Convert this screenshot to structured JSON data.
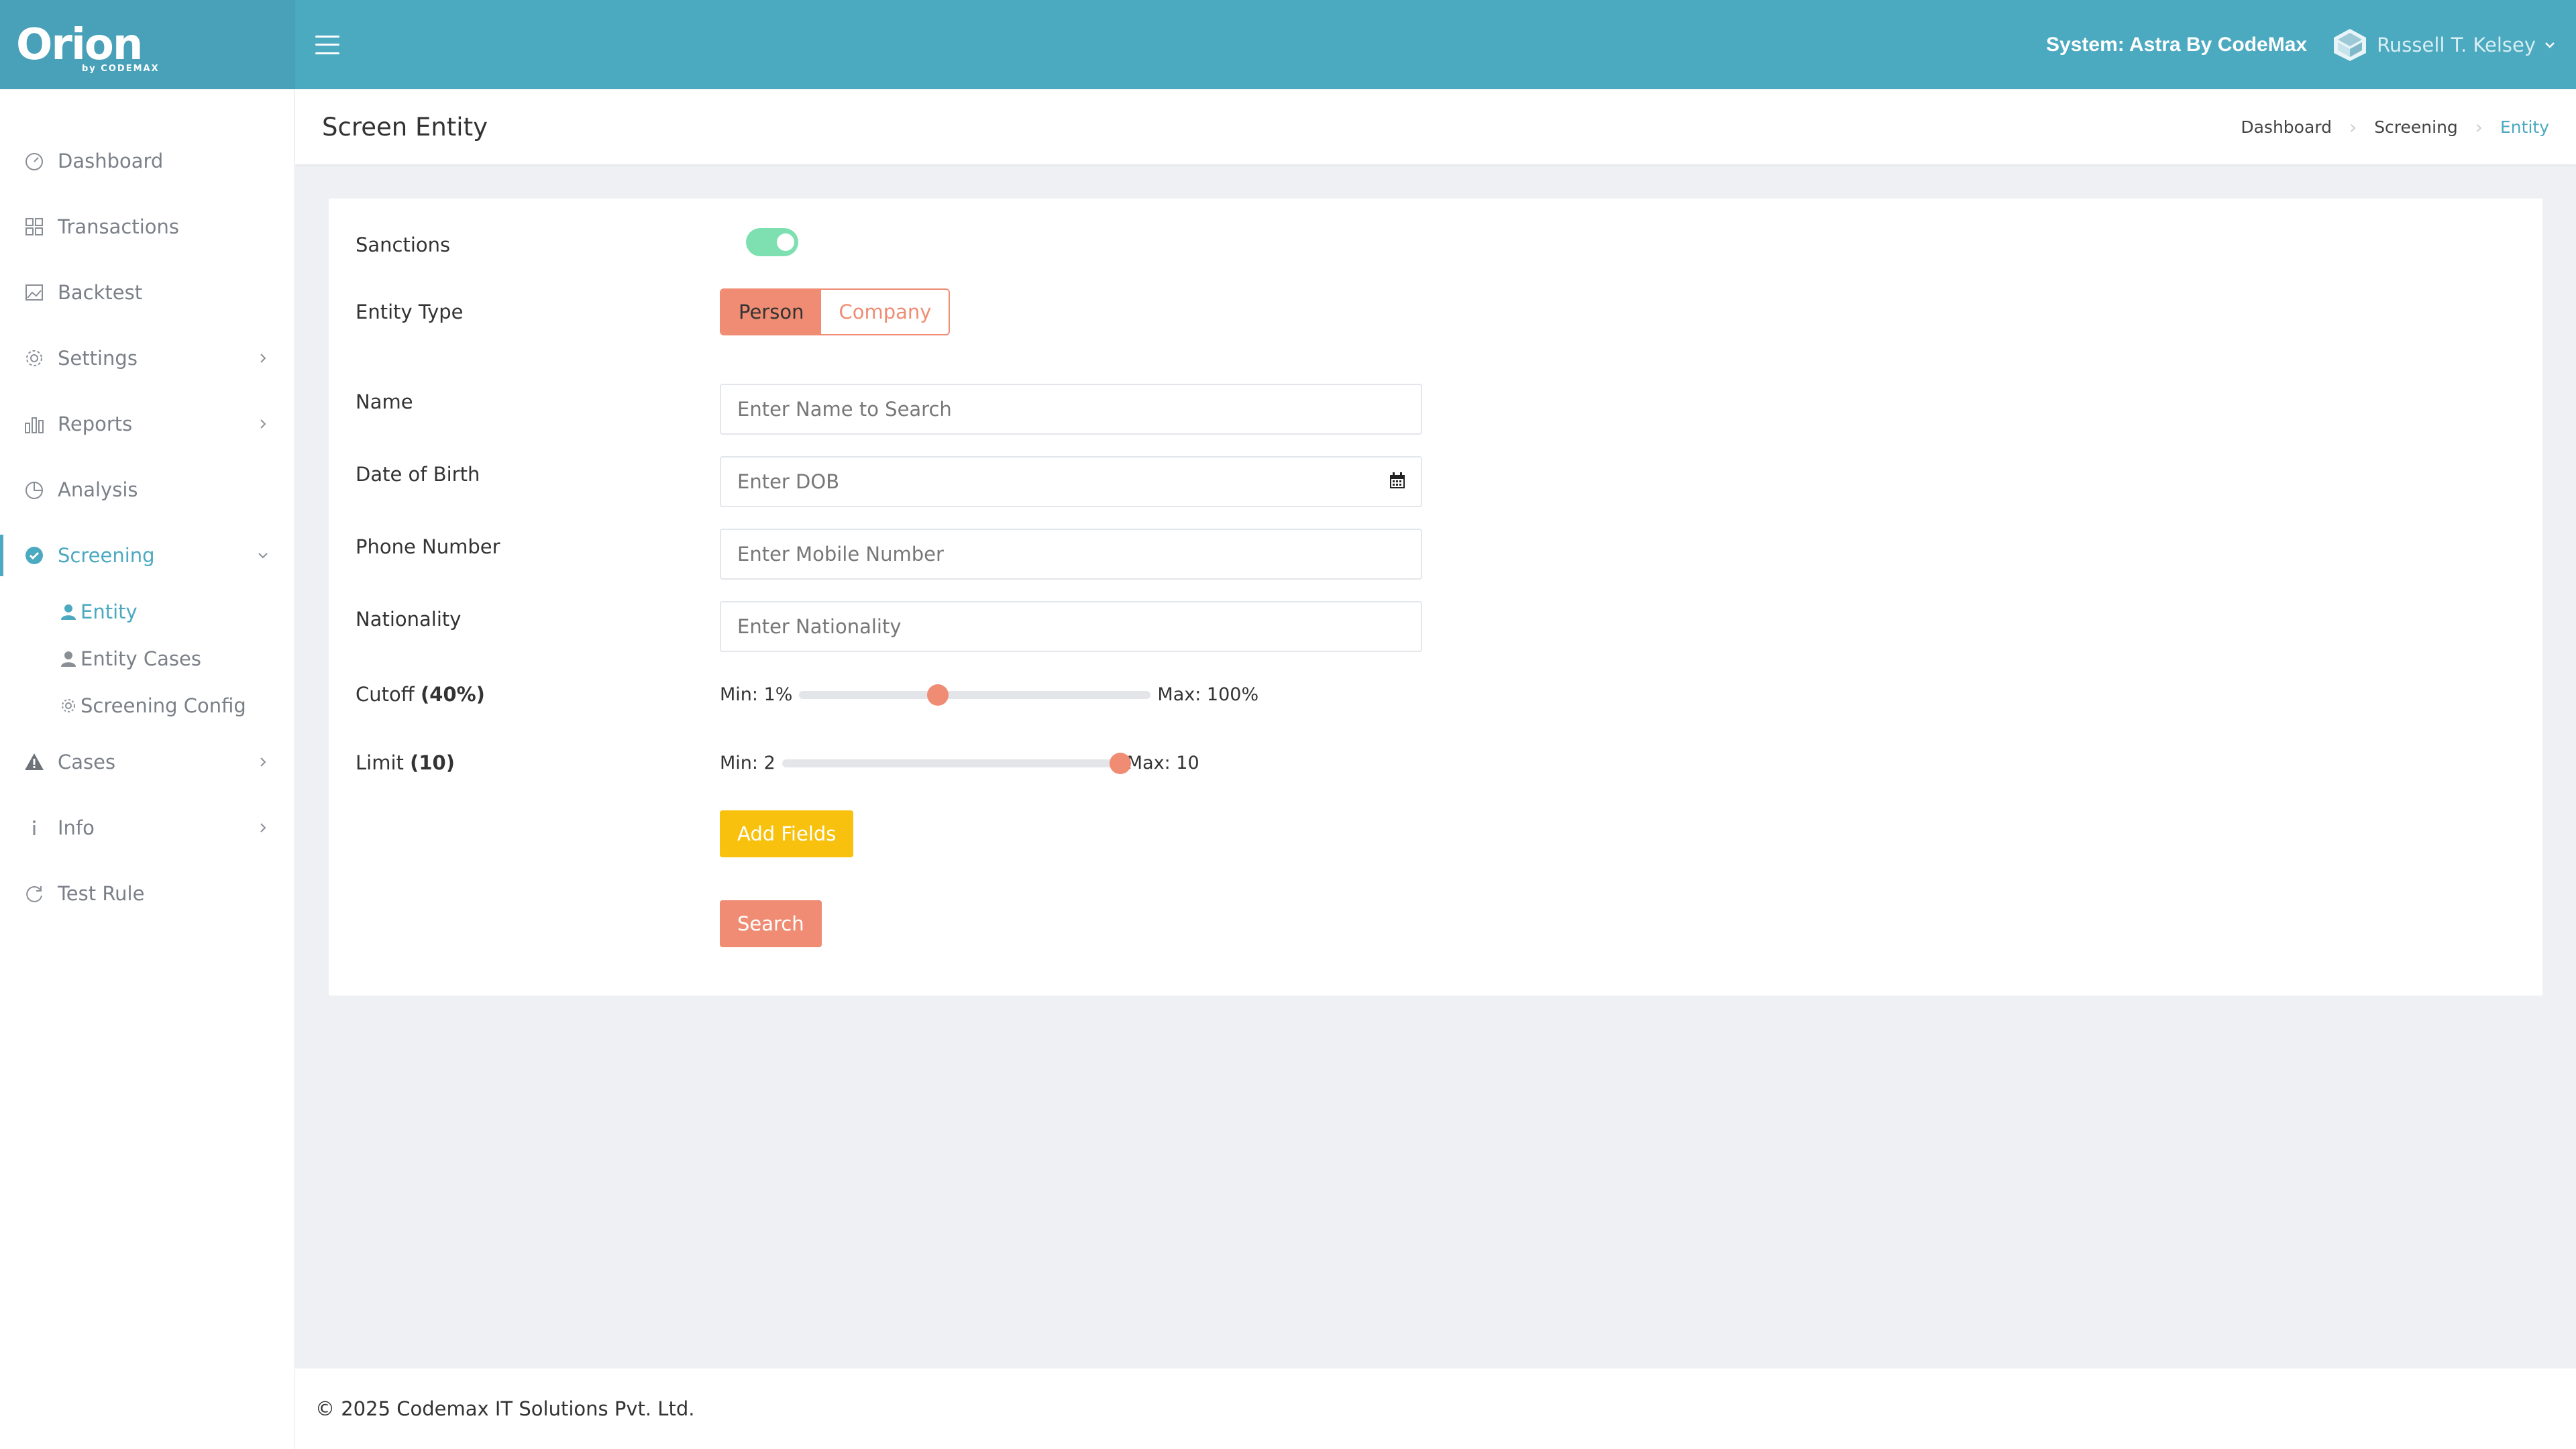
{
  "app": {
    "logo_text": "Orion",
    "logo_sub": "by CODEMAX",
    "system_label": "System: Astra By CodeMax",
    "user_name": "Russell T. Kelsey"
  },
  "sidebar": {
    "items": [
      {
        "label": "Dashboard"
      },
      {
        "label": "Transactions"
      },
      {
        "label": "Backtest"
      },
      {
        "label": "Settings"
      },
      {
        "label": "Reports"
      },
      {
        "label": "Analysis"
      },
      {
        "label": "Screening"
      },
      {
        "label": "Cases"
      },
      {
        "label": "Info"
      },
      {
        "label": "Test Rule"
      }
    ],
    "screening_sub": [
      {
        "label": "Entity"
      },
      {
        "label": "Entity Cases"
      },
      {
        "label": "Screening Config"
      }
    ]
  },
  "header": {
    "title": "Screen Entity",
    "breadcrumb": [
      "Dashboard",
      "Screening",
      "Entity"
    ]
  },
  "form": {
    "sanctions_label": "Sanctions",
    "sanctions_on": true,
    "entity_type_label": "Entity Type",
    "entity_type_options": [
      "Person",
      "Company"
    ],
    "entity_type_selected": "Person",
    "name_label": "Name",
    "name_placeholder": "Enter Name to Search",
    "dob_label": "Date of Birth",
    "dob_placeholder": "Enter DOB",
    "phone_label": "Phone Number",
    "phone_placeholder": "Enter Mobile Number",
    "nationality_label": "Nationality",
    "nationality_placeholder": "Enter Nationality",
    "cutoff_label": "Cutoff",
    "cutoff_value_text": "(40%)",
    "cutoff_min": "Min: 1%",
    "cutoff_max": "Max: 100%",
    "cutoff_value": 40,
    "cutoff_range": [
      1,
      100
    ],
    "limit_label": "Limit",
    "limit_value_text": "(10)",
    "limit_min": "Min: 2",
    "limit_max": "Max: 10",
    "limit_value": 10,
    "limit_range": [
      2,
      10
    ],
    "add_fields_label": "Add Fields",
    "search_label": "Search"
  },
  "footer": {
    "text": "© 2025 Codemax IT Solutions Pvt. Ltd."
  },
  "colors": {
    "brand": "#4ba9c0",
    "accent": "#ef8c73",
    "toggle_on": "#7ee0b1",
    "add_fields": "#f7c10d"
  }
}
